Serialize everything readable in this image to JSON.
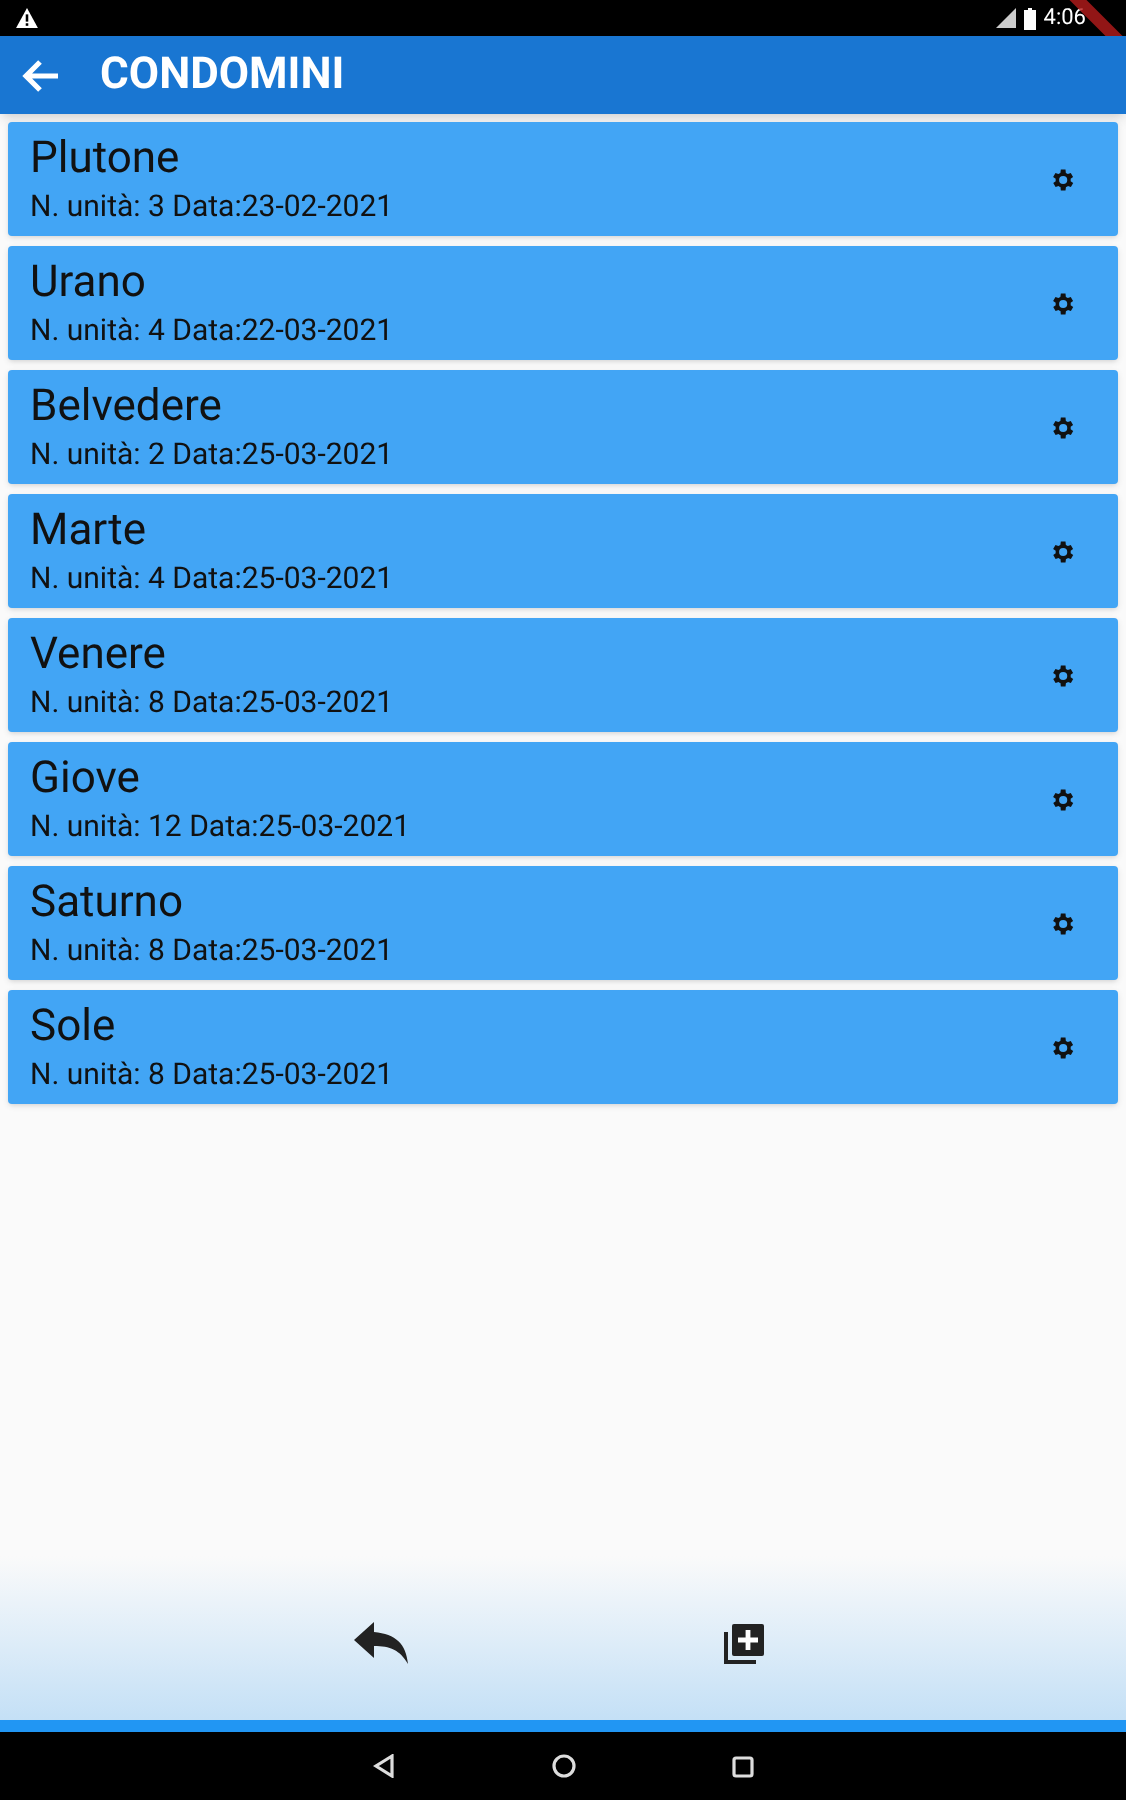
{
  "status_bar": {
    "time": "4:06"
  },
  "app_bar": {
    "title": "CONDOMINI"
  },
  "condomini": [
    {
      "name": "Plutone",
      "details": "N. unità: 3 Data:23-02-2021"
    },
    {
      "name": "Urano",
      "details": "N. unità: 4 Data:22-03-2021"
    },
    {
      "name": "Belvedere",
      "details": "N. unità: 2 Data:25-03-2021"
    },
    {
      "name": "Marte",
      "details": "N. unità: 4 Data:25-03-2021"
    },
    {
      "name": "Venere",
      "details": "N. unità: 8 Data:25-03-2021"
    },
    {
      "name": "Giove",
      "details": "N. unità: 12 Data:25-03-2021"
    },
    {
      "name": "Saturno",
      "details": "N. unità: 8 Data:25-03-2021"
    },
    {
      "name": "Sole",
      "details": "N. unità: 8 Data:25-03-2021"
    }
  ]
}
